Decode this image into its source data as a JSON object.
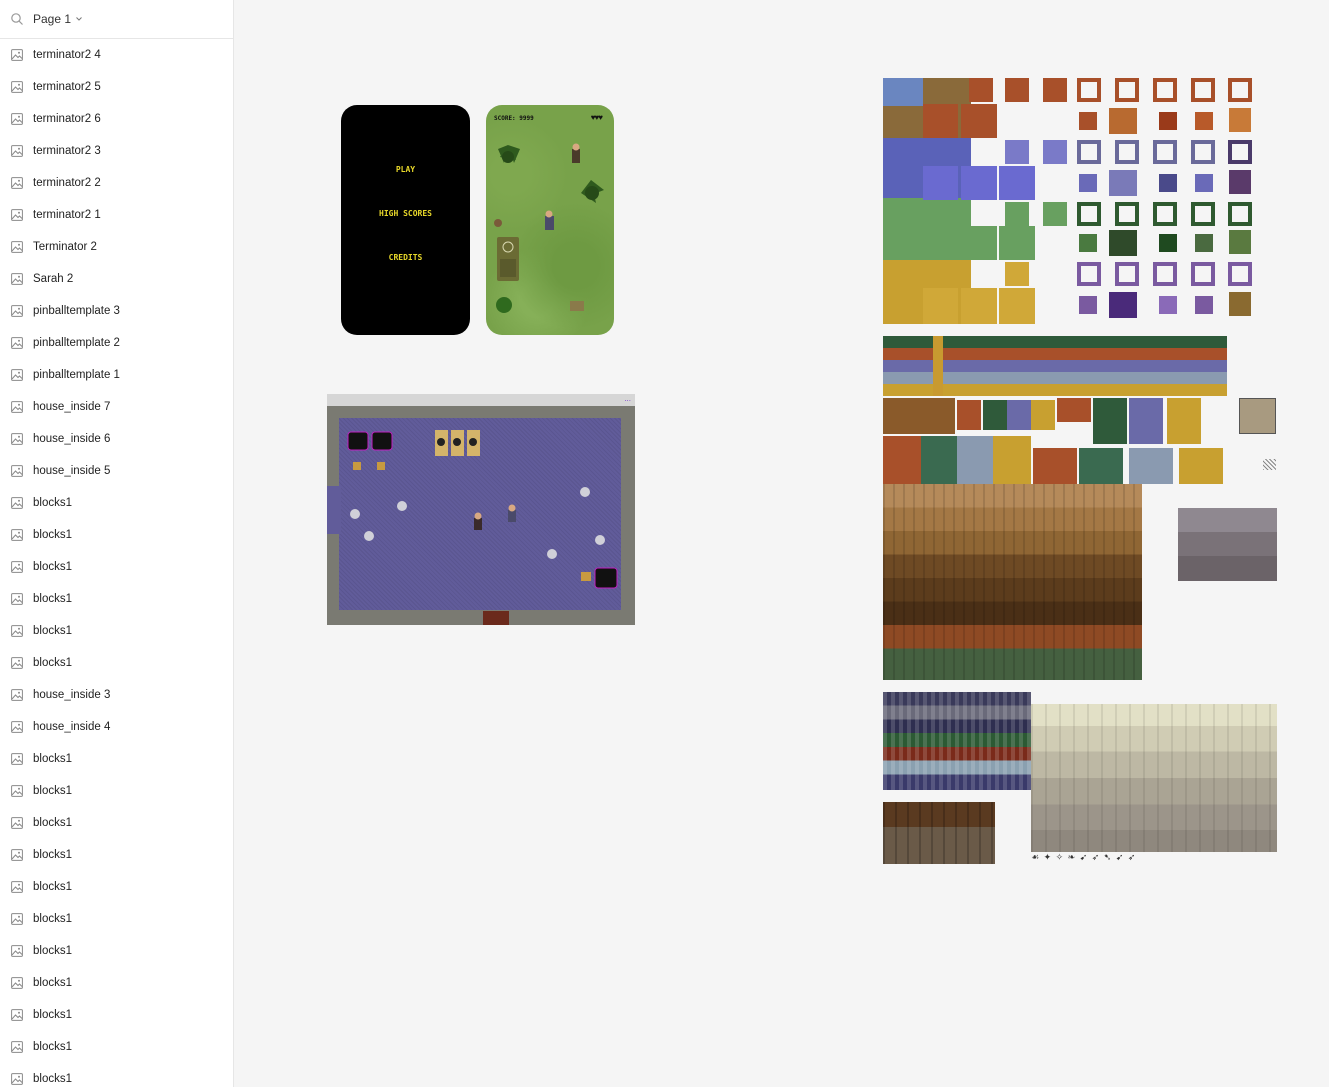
{
  "page_bar": {
    "label": "Page 1"
  },
  "layers": [
    "terminator2 4",
    "terminator2 5",
    "terminator2 6",
    "terminator2 3",
    "terminator2 2",
    "terminator2 1",
    "Terminator 2",
    "Sarah 2",
    "pinballtemplate 3",
    "pinballtemplate 2",
    "pinballtemplate 1",
    "house_inside 7",
    "house_inside 6",
    "house_inside 5",
    "blocks1",
    "blocks1",
    "blocks1",
    "blocks1",
    "blocks1",
    "blocks1",
    "house_inside 3",
    "house_inside 4",
    "blocks1",
    "blocks1",
    "blocks1",
    "blocks1",
    "blocks1",
    "blocks1",
    "blocks1",
    "blocks1",
    "blocks1",
    "blocks1",
    "blocks1"
  ],
  "menu_phone": {
    "items": [
      "PLAY",
      "HIGH SCORES",
      "CREDITS"
    ],
    "text_color": "#e8d82a"
  },
  "game_phone": {
    "score": "SCORE: 9999",
    "hearts": "♥♥♥"
  },
  "house": {
    "dots": "..."
  },
  "sprites_row": "☙ ✦ ✧ ❧ ➹ ➶ ➷ ➹ ➶",
  "colors": {
    "canvas_bg": "#f5f5f5",
    "sidebar_bg": "#ffffff",
    "house_floor": "#615c9a"
  }
}
